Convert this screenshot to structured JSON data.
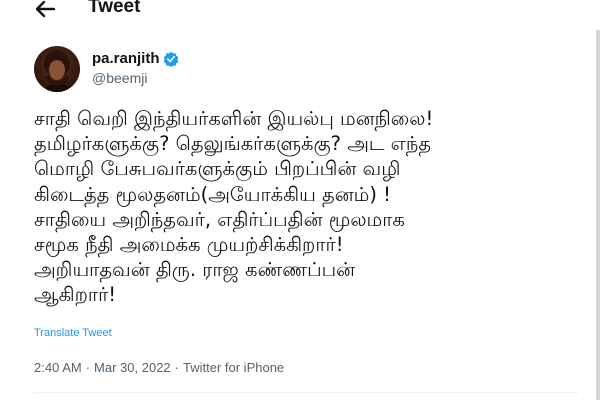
{
  "header": {
    "title": "Tweet",
    "back_icon": "arrow-left-icon"
  },
  "author": {
    "name": "pa.ranjith",
    "handle": "@beemji",
    "verified_icon": "verified-badge-icon",
    "verified_color": "#1d9bf0"
  },
  "tweet": {
    "text": "சாதி வெறி இந்தியர்களின் இயல்பு மனநிலை!\nதமிழர்களுக்கு? தெலுங்கர்களுக்கு? அட எந்த\nமொழி பேசுபவர்களுக்கும் பிறப்பின் வழி\nகிடைத்த மூலதனம்(அயோக்கிய தனம்) !\nசாதியை அறிந்தவர், எதிர்ப்பதின் மூலமாக\nசமூக நீதி அமைக்க முயற்சிக்கிறார்!\nஅறியாதவன் திரு. ராஜ கண்ணப்பன்\nஆகிறார்!",
    "translate_label": "Translate Tweet"
  },
  "meta": {
    "time": "2:40 AM",
    "separator": "·",
    "date": "Mar 30, 2022",
    "source": "Twitter for iPhone"
  },
  "colors": {
    "link": "#1d9bf0",
    "secondary_text": "#536471",
    "primary_text": "#0f1419"
  }
}
